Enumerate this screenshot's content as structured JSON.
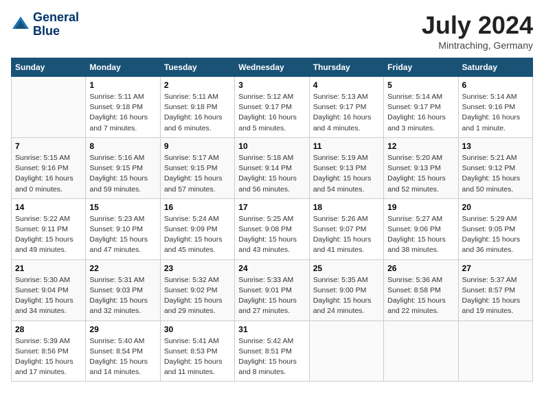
{
  "header": {
    "logo_line1": "General",
    "logo_line2": "Blue",
    "month": "July 2024",
    "location": "Mintraching, Germany"
  },
  "weekdays": [
    "Sunday",
    "Monday",
    "Tuesday",
    "Wednesday",
    "Thursday",
    "Friday",
    "Saturday"
  ],
  "weeks": [
    [
      {
        "num": "",
        "info": ""
      },
      {
        "num": "1",
        "info": "Sunrise: 5:11 AM\nSunset: 9:18 PM\nDaylight: 16 hours\nand 7 minutes."
      },
      {
        "num": "2",
        "info": "Sunrise: 5:11 AM\nSunset: 9:18 PM\nDaylight: 16 hours\nand 6 minutes."
      },
      {
        "num": "3",
        "info": "Sunrise: 5:12 AM\nSunset: 9:17 PM\nDaylight: 16 hours\nand 5 minutes."
      },
      {
        "num": "4",
        "info": "Sunrise: 5:13 AM\nSunset: 9:17 PM\nDaylight: 16 hours\nand 4 minutes."
      },
      {
        "num": "5",
        "info": "Sunrise: 5:14 AM\nSunset: 9:17 PM\nDaylight: 16 hours\nand 3 minutes."
      },
      {
        "num": "6",
        "info": "Sunrise: 5:14 AM\nSunset: 9:16 PM\nDaylight: 16 hours\nand 1 minute."
      }
    ],
    [
      {
        "num": "7",
        "info": "Sunrise: 5:15 AM\nSunset: 9:16 PM\nDaylight: 16 hours\nand 0 minutes."
      },
      {
        "num": "8",
        "info": "Sunrise: 5:16 AM\nSunset: 9:15 PM\nDaylight: 15 hours\nand 59 minutes."
      },
      {
        "num": "9",
        "info": "Sunrise: 5:17 AM\nSunset: 9:15 PM\nDaylight: 15 hours\nand 57 minutes."
      },
      {
        "num": "10",
        "info": "Sunrise: 5:18 AM\nSunset: 9:14 PM\nDaylight: 15 hours\nand 56 minutes."
      },
      {
        "num": "11",
        "info": "Sunrise: 5:19 AM\nSunset: 9:13 PM\nDaylight: 15 hours\nand 54 minutes."
      },
      {
        "num": "12",
        "info": "Sunrise: 5:20 AM\nSunset: 9:13 PM\nDaylight: 15 hours\nand 52 minutes."
      },
      {
        "num": "13",
        "info": "Sunrise: 5:21 AM\nSunset: 9:12 PM\nDaylight: 15 hours\nand 50 minutes."
      }
    ],
    [
      {
        "num": "14",
        "info": "Sunrise: 5:22 AM\nSunset: 9:11 PM\nDaylight: 15 hours\nand 49 minutes."
      },
      {
        "num": "15",
        "info": "Sunrise: 5:23 AM\nSunset: 9:10 PM\nDaylight: 15 hours\nand 47 minutes."
      },
      {
        "num": "16",
        "info": "Sunrise: 5:24 AM\nSunset: 9:09 PM\nDaylight: 15 hours\nand 45 minutes."
      },
      {
        "num": "17",
        "info": "Sunrise: 5:25 AM\nSunset: 9:08 PM\nDaylight: 15 hours\nand 43 minutes."
      },
      {
        "num": "18",
        "info": "Sunrise: 5:26 AM\nSunset: 9:07 PM\nDaylight: 15 hours\nand 41 minutes."
      },
      {
        "num": "19",
        "info": "Sunrise: 5:27 AM\nSunset: 9:06 PM\nDaylight: 15 hours\nand 38 minutes."
      },
      {
        "num": "20",
        "info": "Sunrise: 5:29 AM\nSunset: 9:05 PM\nDaylight: 15 hours\nand 36 minutes."
      }
    ],
    [
      {
        "num": "21",
        "info": "Sunrise: 5:30 AM\nSunset: 9:04 PM\nDaylight: 15 hours\nand 34 minutes."
      },
      {
        "num": "22",
        "info": "Sunrise: 5:31 AM\nSunset: 9:03 PM\nDaylight: 15 hours\nand 32 minutes."
      },
      {
        "num": "23",
        "info": "Sunrise: 5:32 AM\nSunset: 9:02 PM\nDaylight: 15 hours\nand 29 minutes."
      },
      {
        "num": "24",
        "info": "Sunrise: 5:33 AM\nSunset: 9:01 PM\nDaylight: 15 hours\nand 27 minutes."
      },
      {
        "num": "25",
        "info": "Sunrise: 5:35 AM\nSunset: 9:00 PM\nDaylight: 15 hours\nand 24 minutes."
      },
      {
        "num": "26",
        "info": "Sunrise: 5:36 AM\nSunset: 8:58 PM\nDaylight: 15 hours\nand 22 minutes."
      },
      {
        "num": "27",
        "info": "Sunrise: 5:37 AM\nSunset: 8:57 PM\nDaylight: 15 hours\nand 19 minutes."
      }
    ],
    [
      {
        "num": "28",
        "info": "Sunrise: 5:39 AM\nSunset: 8:56 PM\nDaylight: 15 hours\nand 17 minutes."
      },
      {
        "num": "29",
        "info": "Sunrise: 5:40 AM\nSunset: 8:54 PM\nDaylight: 15 hours\nand 14 minutes."
      },
      {
        "num": "30",
        "info": "Sunrise: 5:41 AM\nSunset: 8:53 PM\nDaylight: 15 hours\nand 11 minutes."
      },
      {
        "num": "31",
        "info": "Sunrise: 5:42 AM\nSunset: 8:51 PM\nDaylight: 15 hours\nand 8 minutes."
      },
      {
        "num": "",
        "info": ""
      },
      {
        "num": "",
        "info": ""
      },
      {
        "num": "",
        "info": ""
      }
    ]
  ]
}
